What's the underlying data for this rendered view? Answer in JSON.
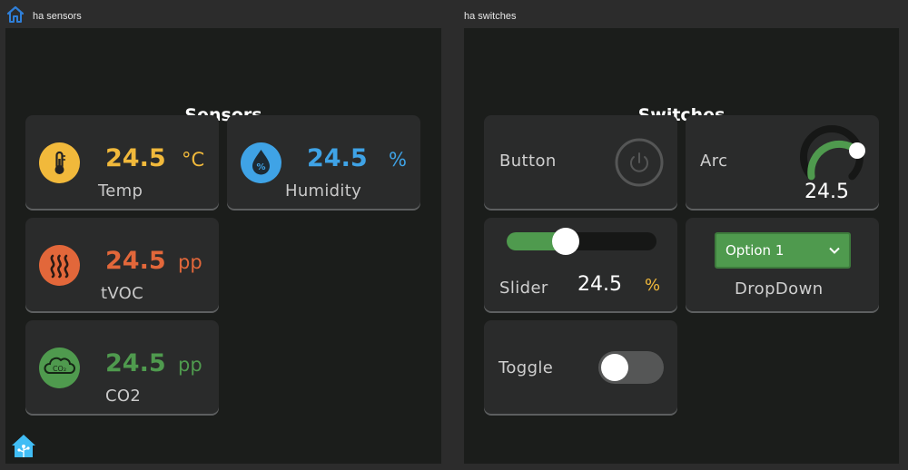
{
  "windows": {
    "left_title": "ha sensors",
    "right_title": "ha switches"
  },
  "sensors": {
    "title": "Sensors",
    "temp": {
      "value": "24.5",
      "unit": "°C",
      "label": "Temp",
      "color": "#f1b93b"
    },
    "humidity": {
      "value": "24.5",
      "unit": "%",
      "label": "Humidity",
      "color": "#3fa3e6"
    },
    "tvoc": {
      "value": "24.5",
      "unit": "pp",
      "label": "tVOC",
      "color": "#e2673a"
    },
    "co2": {
      "value": "24.5",
      "unit": "pp",
      "label": "CO2",
      "color": "#4f9a4e",
      "icon_text": "CO₂"
    }
  },
  "switches": {
    "title": "Switches",
    "button": {
      "label": "Button"
    },
    "arc": {
      "label": "Arc",
      "value": "24.5",
      "level_fraction": 0.55
    },
    "slider": {
      "label": "Slider",
      "value": "24.5",
      "unit": "%",
      "level_fraction": 0.4
    },
    "dropdown": {
      "selected": "Option 1",
      "label": "DropDown"
    },
    "toggle": {
      "label": "Toggle",
      "state": "off"
    }
  },
  "icons": {
    "home": "home-icon",
    "home_assistant_logo": "home-assistant-logo-icon"
  },
  "colors": {
    "panel_bg": "#1b1d1b",
    "card_bg": "#2a2b2b",
    "accent_green": "#4f9a4e",
    "unit_yellow": "#f1b93b"
  }
}
